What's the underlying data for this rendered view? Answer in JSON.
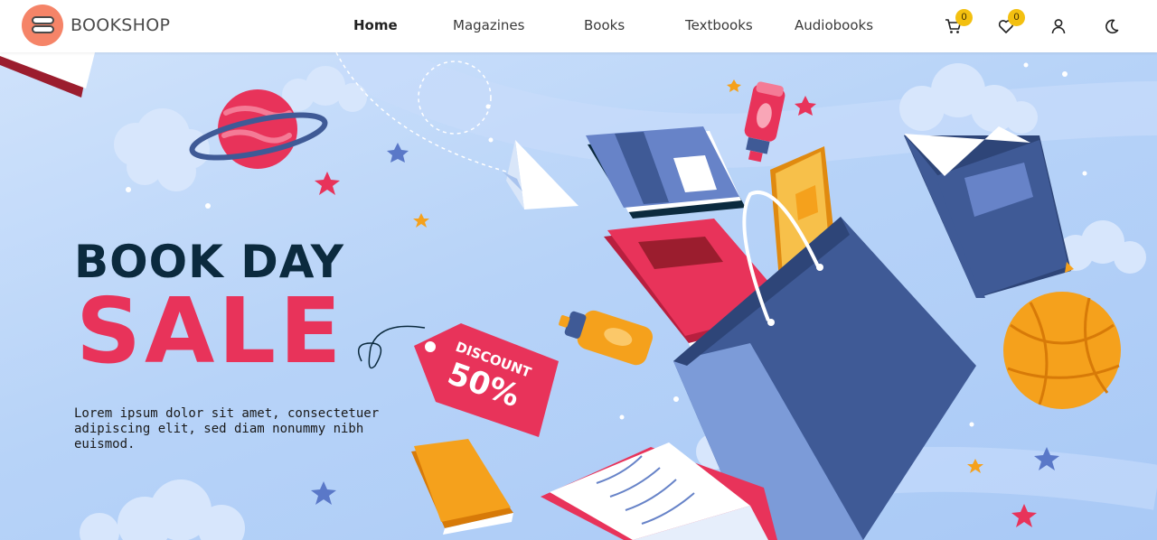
{
  "header": {
    "brand": "BOOKSHOP",
    "nav": [
      {
        "label": "Home",
        "active": true
      },
      {
        "label": "Magazines",
        "active": false
      },
      {
        "label": "Books",
        "active": false
      },
      {
        "label": "Textbooks",
        "active": false
      },
      {
        "label": "Audiobooks",
        "active": false
      }
    ],
    "cart_count": "0",
    "wishlist_count": "0",
    "icons": [
      "cart-icon",
      "heart-icon",
      "user-icon",
      "moon-icon"
    ]
  },
  "hero": {
    "title_line1": "BOOK DAY",
    "title_line2": "SALE",
    "tag_line1": "DISCOUNT",
    "tag_line2": "50%",
    "description": "Lorem ipsum dolor sit amet, consectetuer adipiscing elit, sed diam nonummy nibh euismod."
  },
  "colors": {
    "accent": "#e8335a",
    "title_dark": "#0b2a3e",
    "badge": "#f3c010",
    "bag": "#3f5a96",
    "orange": "#f5a11c"
  }
}
